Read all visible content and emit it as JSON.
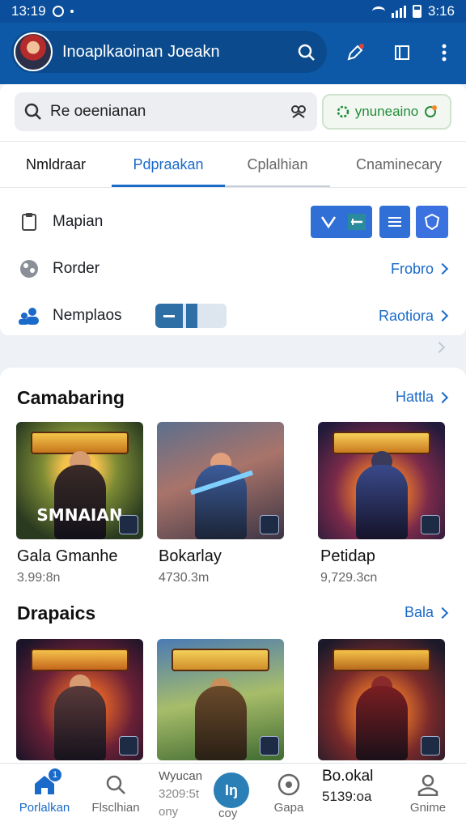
{
  "status_bar": {
    "time_left": "13:19",
    "time_right": "3:16"
  },
  "app_bar": {
    "title": "Inoaplkaoinan Joeakn"
  },
  "search": {
    "value": "Re oeenianan"
  },
  "promo": {
    "label": "ynuneaino"
  },
  "tabs": [
    "Nmldraar",
    "Pdpraakan",
    "Cplalhian",
    "Cnaminecary"
  ],
  "rows": [
    {
      "label": "Mapian",
      "link": ""
    },
    {
      "label": "Rorder",
      "link": "Frobro"
    },
    {
      "label": "Nemplaos",
      "link": "Raotiora"
    }
  ],
  "sections": [
    {
      "title": "Camabaring",
      "link": "Hattla",
      "games": [
        {
          "name": "Gala Gmanhe",
          "size": "3.99:8n",
          "overlay": "SMNAIAN",
          "banner": "#d6a13a"
        },
        {
          "name": "Bokarlay",
          "size": "4730.3m",
          "overlay": "",
          "banner": ""
        },
        {
          "name": "Petidap",
          "size": "9,729.3cn",
          "overlay": "",
          "banner": "#e6b545"
        }
      ]
    },
    {
      "title": "Drapaics",
      "link": "Bala",
      "games": [
        {
          "name": "",
          "size": "",
          "overlay": "",
          "banner": "#e8a33a"
        },
        {
          "name": "",
          "size": "",
          "overlay": "",
          "banner": "#e2c04b"
        },
        {
          "name": "",
          "size": "",
          "overlay": "",
          "banner": "#d89b33"
        }
      ]
    }
  ],
  "bottom_nav": {
    "items": [
      "Porlalkan",
      "Flsclhian",
      "",
      "Gapa",
      "Gnime"
    ],
    "badge": "1",
    "fab": "Iŋ",
    "mini_text_1": "Wyucan",
    "mini_text_2": "3209:5t",
    "mini_text_3": "ony",
    "fab_label": "coy",
    "info_title": "Bo.okal",
    "info_value": "5139:oa"
  },
  "colors": {
    "primary": "#0d59a8",
    "accent": "#1a6ac9",
    "promo_green": "#238b3a"
  }
}
